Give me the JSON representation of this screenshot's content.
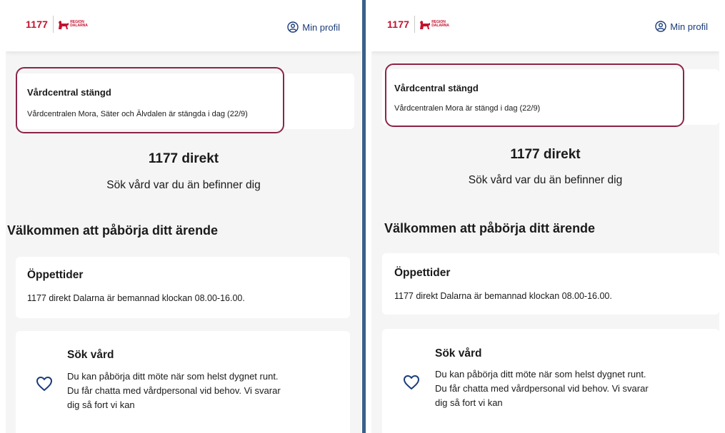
{
  "brand": {
    "logo_text": "1177",
    "region_line1": "REGION",
    "region_line2": "DALARNA",
    "accent_color": "#c4122f"
  },
  "left": {
    "profile_label": "Min profil",
    "alert": {
      "title": "Vårdcentral stängd",
      "body": "Vårdcentralen Mora, Säter och Älvdalen är stängda i dag (22/9)"
    },
    "hero": {
      "title": "1177 direkt",
      "subtitle": "Sök vård var du än befinner dig"
    },
    "section_title": "Välkommen att påbörja ditt ärende",
    "hours": {
      "title": "Öppettider",
      "text": "1177 direkt Dalarna är bemannad klockan 08.00-16.00."
    },
    "care": {
      "title": "Sök vård",
      "line1": "Du kan påbörja ditt möte när som helst dygnet runt.",
      "line2": "Du får chatta med vårdpersonal vid behov. Vi svarar",
      "line3": "dig så fort vi kan",
      "icon": "heart-icon"
    }
  },
  "right": {
    "profile_label": "Min profil",
    "alert": {
      "title": "Vårdcentral stängd",
      "body": "Vårdcentralen Mora är stängd i dag (22/9)"
    },
    "hero": {
      "title": "1177 direkt",
      "subtitle": "Sök vård var du än befinner dig"
    },
    "section_title": "Välkommen att påbörja ditt ärende",
    "hours": {
      "title": "Öppettider",
      "text": "1177 direkt Dalarna är bemannad klockan 08.00-16.00."
    },
    "care": {
      "title": "Sök vård",
      "line1": "Du kan påbörja ditt möte när som helst dygnet runt.",
      "line2": "Du får chatta med vårdpersonal vid behov. Vi svarar",
      "line3": "dig så fort vi kan",
      "icon": "heart-icon"
    }
  },
  "colors": {
    "outline": "#8a2549",
    "link": "#1b3b7a",
    "divider": "#3a5f8a",
    "background": "#f5f5f5"
  }
}
